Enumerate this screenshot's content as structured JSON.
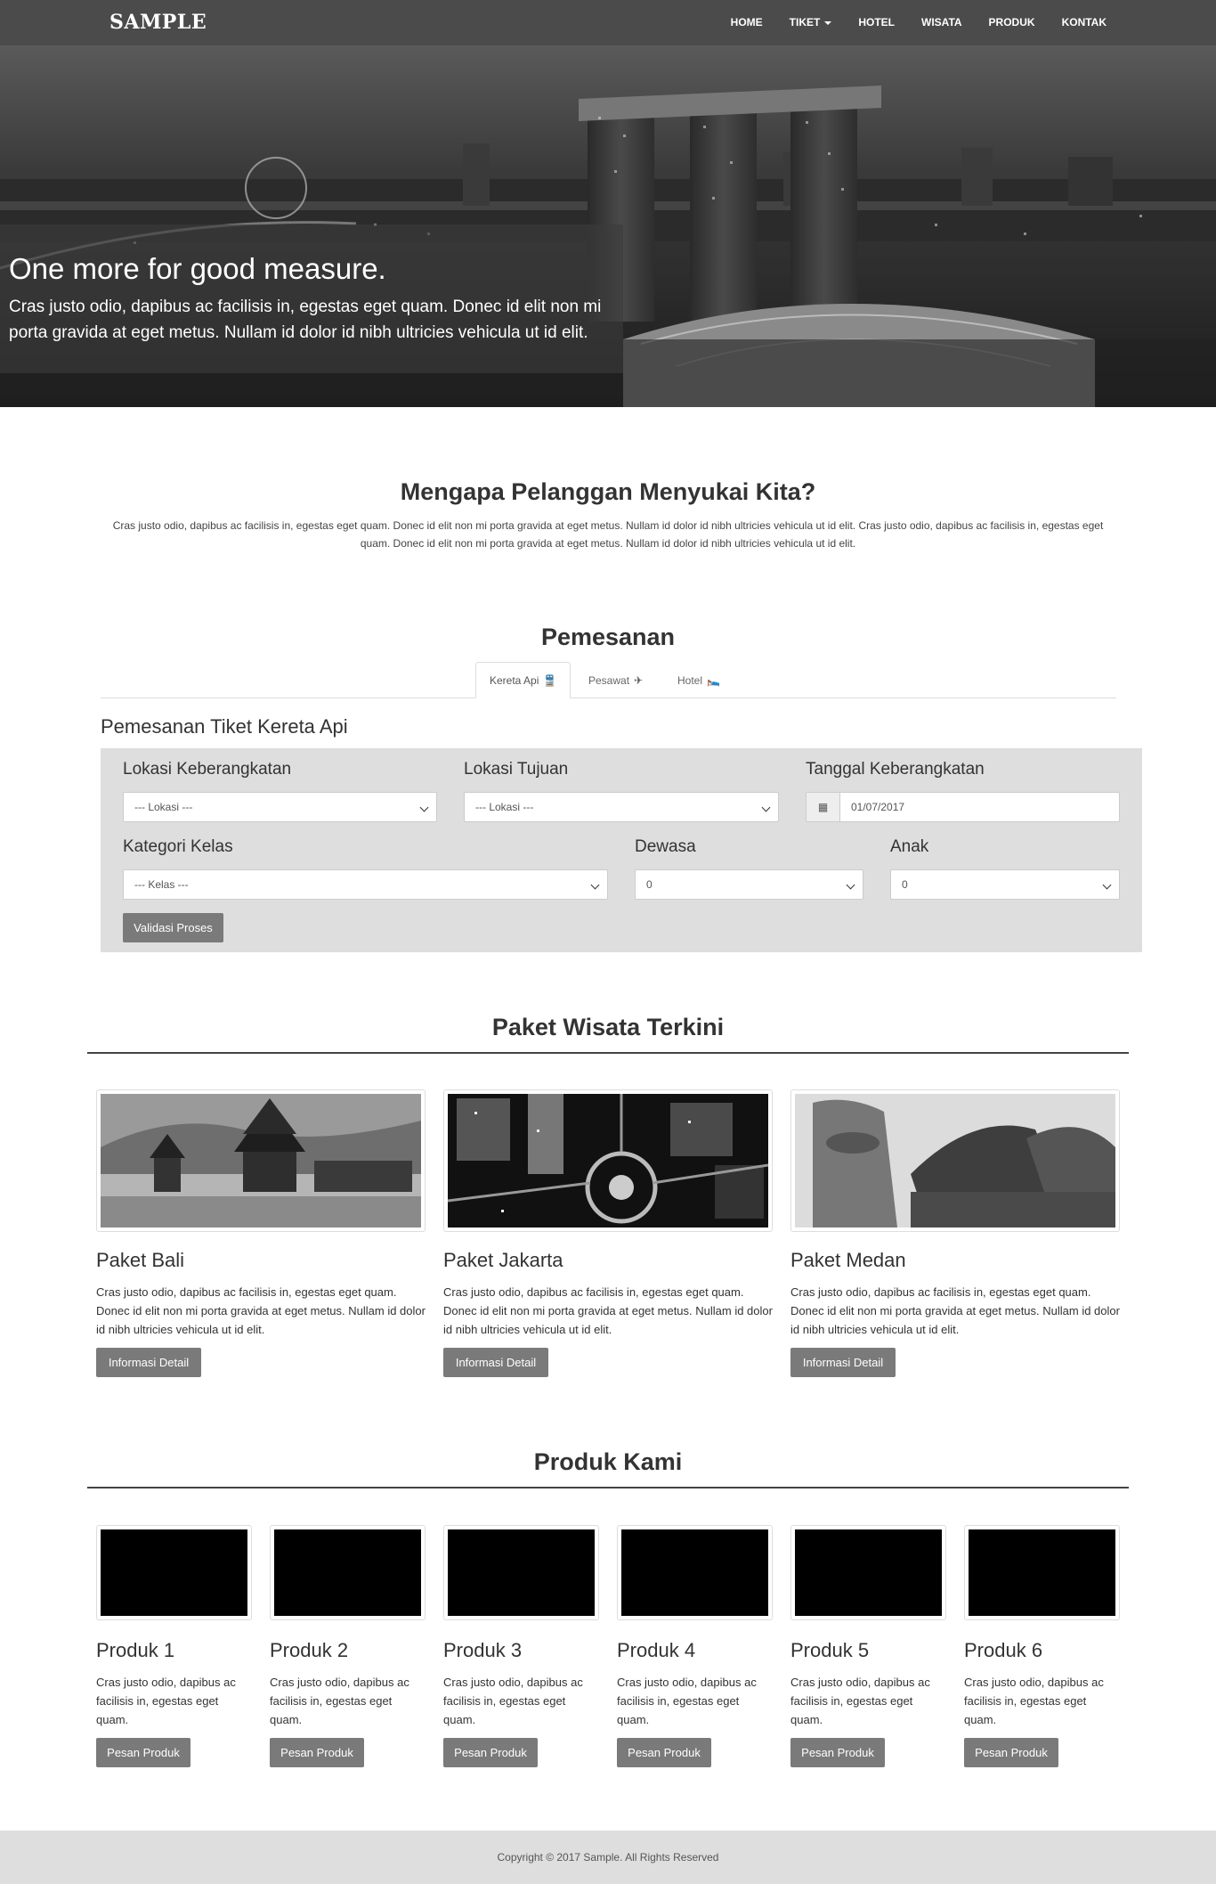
{
  "brand": "SAMPLE",
  "nav": [
    {
      "label": "HOME"
    },
    {
      "label": "TIKET"
    },
    {
      "label": "HOTEL"
    },
    {
      "label": "WISATA"
    },
    {
      "label": "PRODUK"
    },
    {
      "label": "KONTAK"
    }
  ],
  "hero": {
    "title": "One more for good measure.",
    "text": "Cras justo odio, dapibus ac facilisis in, egestas eget quam. Donec id elit non mi porta gravida at eget metus. Nullam id dolor id nibh ultricies vehicula ut id elit."
  },
  "why": {
    "title": "Mengapa Pelanggan Menyukai Kita?",
    "text": "Cras justo odio, dapibus ac facilisis in, egestas eget quam. Donec id elit non mi porta gravida at eget metus. Nullam id dolor id nibh ultricies vehicula ut id elit. Cras justo odio, dapibus ac facilisis in, egestas eget quam. Donec id elit non mi porta gravida at eget metus. Nullam id dolor id nibh ultricies vehicula ut id elit."
  },
  "booking": {
    "title": "Pemesanan",
    "tabs": [
      {
        "label": "Kereta Api",
        "icon": "train-icon"
      },
      {
        "label": "Pesawat",
        "icon": "plane-icon"
      },
      {
        "label": "Hotel",
        "icon": "bed-icon"
      }
    ],
    "form_title": "Pemesanan Tiket Kereta Api",
    "departure_label": "Lokasi Keberangkatan",
    "departure_value": "--- Lokasi ---",
    "destination_label": "Lokasi Tujuan",
    "destination_value": "--- Lokasi ---",
    "date_label": "Tanggal Keberangkatan",
    "date_value": "01/07/2017",
    "class_label": "Kategori Kelas",
    "class_value": "--- Kelas ---",
    "adult_label": "Dewasa",
    "adult_value": "0",
    "child_label": "Anak",
    "child_value": "0",
    "submit_label": "Validasi Proses"
  },
  "packages": {
    "title": "Paket Wisata Terkini",
    "items": [
      {
        "title": "Paket Bali",
        "text": "Cras justo odio, dapibus ac facilisis in, egestas eget quam. Donec id elit non mi porta gravida at eget metus. Nullam id dolor id nibh ultricies vehicula ut id elit.",
        "button": "Informasi Detail"
      },
      {
        "title": "Paket Jakarta",
        "text": "Cras justo odio, dapibus ac facilisis in, egestas eget quam. Donec id elit non mi porta gravida at eget metus. Nullam id dolor id nibh ultricies vehicula ut id elit.",
        "button": "Informasi Detail"
      },
      {
        "title": "Paket Medan",
        "text": "Cras justo odio, dapibus ac facilisis in, egestas eget quam. Donec id elit non mi porta gravida at eget metus. Nullam id dolor id nibh ultricies vehicula ut id elit.",
        "button": "Informasi Detail"
      }
    ]
  },
  "products": {
    "title": "Produk Kami",
    "items": [
      {
        "title": "Produk 1",
        "text": "Cras justo odio, dapibus ac facilisis in, egestas eget quam.",
        "button": "Pesan Produk"
      },
      {
        "title": "Produk 2",
        "text": "Cras justo odio, dapibus ac facilisis in, egestas eget quam.",
        "button": "Pesan Produk"
      },
      {
        "title": "Produk 3",
        "text": "Cras justo odio, dapibus ac facilisis in, egestas eget quam.",
        "button": "Pesan Produk"
      },
      {
        "title": "Produk 4",
        "text": "Cras justo odio, dapibus ac facilisis in, egestas eget quam.",
        "button": "Pesan Produk"
      },
      {
        "title": "Produk 5",
        "text": "Cras justo odio, dapibus ac facilisis in, egestas eget quam.",
        "button": "Pesan Produk"
      },
      {
        "title": "Produk 6",
        "text": "Cras justo odio, dapibus ac facilisis in, egestas eget quam.",
        "button": "Pesan Produk"
      }
    ]
  },
  "footer": {
    "text": "Copyright © 2017 Sample. All Rights Reserved"
  },
  "colors": {
    "navbar": "#4b4b4b",
    "button": "#7a7a7a",
    "form_bg": "#dedede",
    "footer_bg": "#dedede"
  }
}
